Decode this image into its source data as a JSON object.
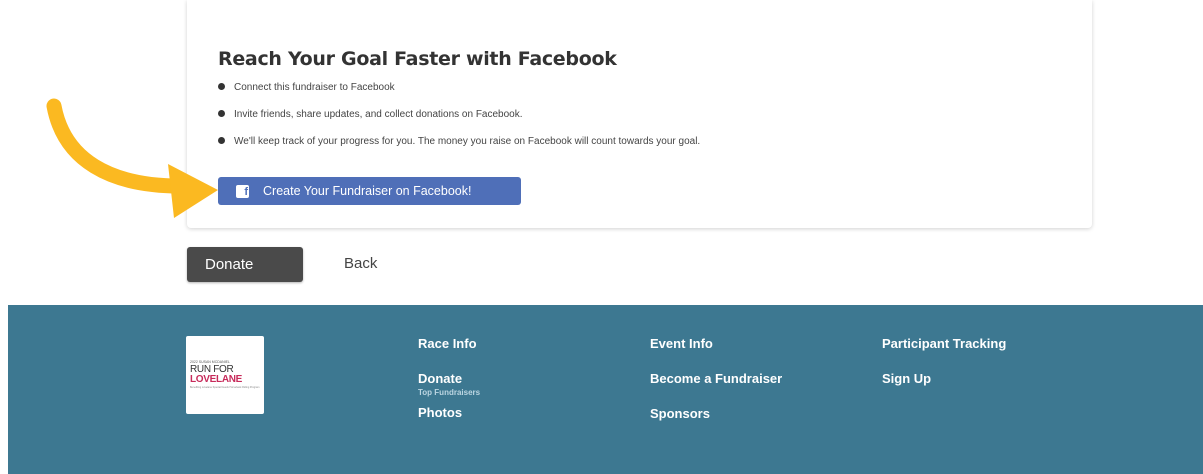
{
  "facebook_card": {
    "title": "Reach Your Goal Faster with Facebook",
    "bullets": [
      "Connect this fundraiser to Facebook",
      "Invite friends, share updates, and collect donations on Facebook.",
      "We'll keep track of your progress for you. The money you raise on Facebook will count towards your goal."
    ],
    "button_label": "Create Your Fundraiser on Facebook!",
    "button_icon": "facebook-icon",
    "button_color": "#4f6fb8"
  },
  "actions": {
    "donate_label": "Donate",
    "back_label": "Back"
  },
  "annotation": {
    "arrow_color": "#fbb921",
    "icon": "arrow-annotation-icon"
  },
  "footer": {
    "background": "#3d7891",
    "logo": {
      "small_text": "2022 SUSAN MCDANIEL",
      "line1": "RUN FOR",
      "line2": "LOVELANE",
      "tagline": "Benefiting Lovelane Special Needs Horseback Riding Program"
    },
    "columns": [
      {
        "items": [
          {
            "label": "Race Info"
          },
          {
            "label": "Donate",
            "sub": "Top Fundraisers"
          },
          {
            "label": "Photos"
          }
        ]
      },
      {
        "items": [
          {
            "label": "Event Info"
          },
          {
            "label": "Become a Fundraiser"
          },
          {
            "label": "Sponsors"
          }
        ]
      },
      {
        "items": [
          {
            "label": "Participant Tracking"
          },
          {
            "label": "Sign Up"
          }
        ]
      }
    ]
  }
}
